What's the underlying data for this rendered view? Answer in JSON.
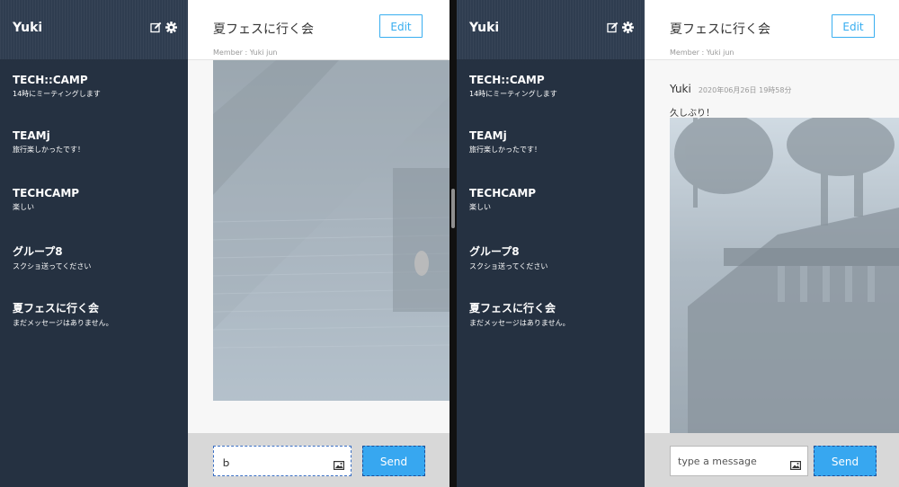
{
  "sidebar": {
    "user_name": "Yuki",
    "icons": [
      "edit-icon",
      "gear-icon"
    ],
    "groups": [
      {
        "name": "TECH::CAMP",
        "last_message": "14時にミーティングします"
      },
      {
        "name": "TEAMj",
        "last_message": "旅行楽しかったです！"
      },
      {
        "name": "TECHCAMP",
        "last_message": "楽しい"
      },
      {
        "name": "グループ8",
        "last_message": "スクショ送ってください"
      },
      {
        "name": "夏フェスに行く会",
        "last_message": "まだメッセージはありません。"
      }
    ]
  },
  "chat": {
    "title": "夏フェスに行く会",
    "member_line": "Member : Yuki jun",
    "edit_label": "Edit",
    "message": {
      "user": "Yuki",
      "date": "2020年06月26日 19時58分",
      "text": "久しぶり！"
    }
  },
  "form": {
    "left_input_value": "ｂ",
    "placeholder": "type a message",
    "send_label": "Send",
    "image_icon": "image-icon"
  },
  "colors": {
    "sidebar_bg": "#253141",
    "sidebar_header_bg": "#2f3d50",
    "accent": "#38aef0",
    "send_bg": "#37a7f0",
    "form_bar_bg": "#d8d8d8"
  }
}
